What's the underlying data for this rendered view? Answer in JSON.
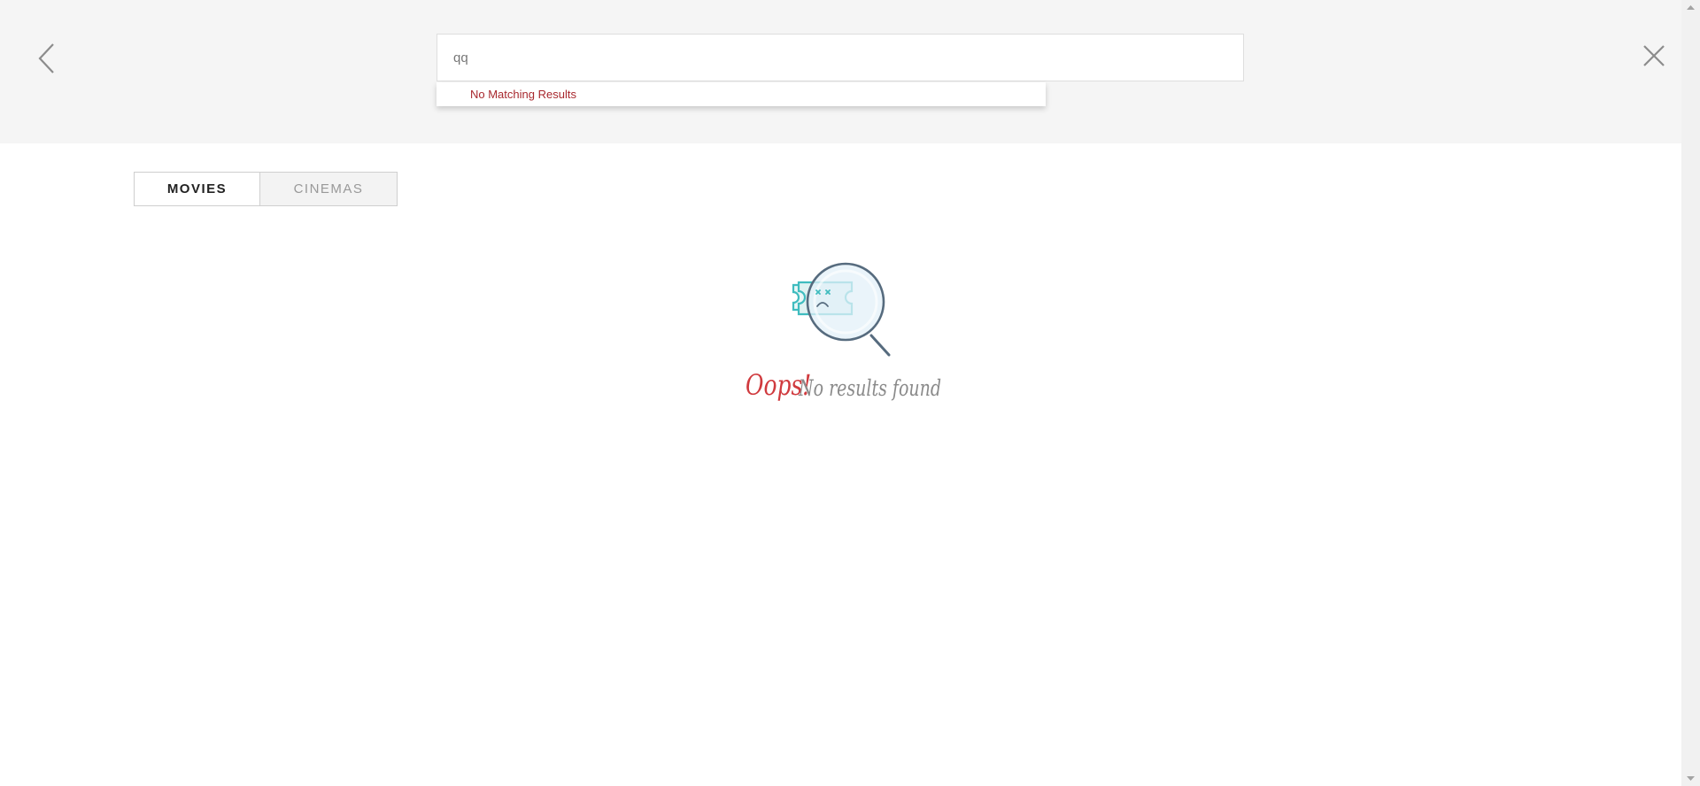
{
  "search": {
    "value": "qq",
    "no_results_text": "No Matching Results"
  },
  "tabs": [
    {
      "label": "MOVIES",
      "active": true
    },
    {
      "label": "CINEMAS",
      "active": false
    }
  ],
  "empty_state": {
    "oops": "Oops!",
    "message": "No results found"
  },
  "icons": {
    "back": "chevron-left-icon",
    "close": "close-icon",
    "illustration": "ticket-magnifier-icon"
  },
  "colors": {
    "accent_red": "#d03a3e",
    "dropdown_red": "#a8282e",
    "teal": "#3fbcbf",
    "slate": "#566b7e"
  }
}
